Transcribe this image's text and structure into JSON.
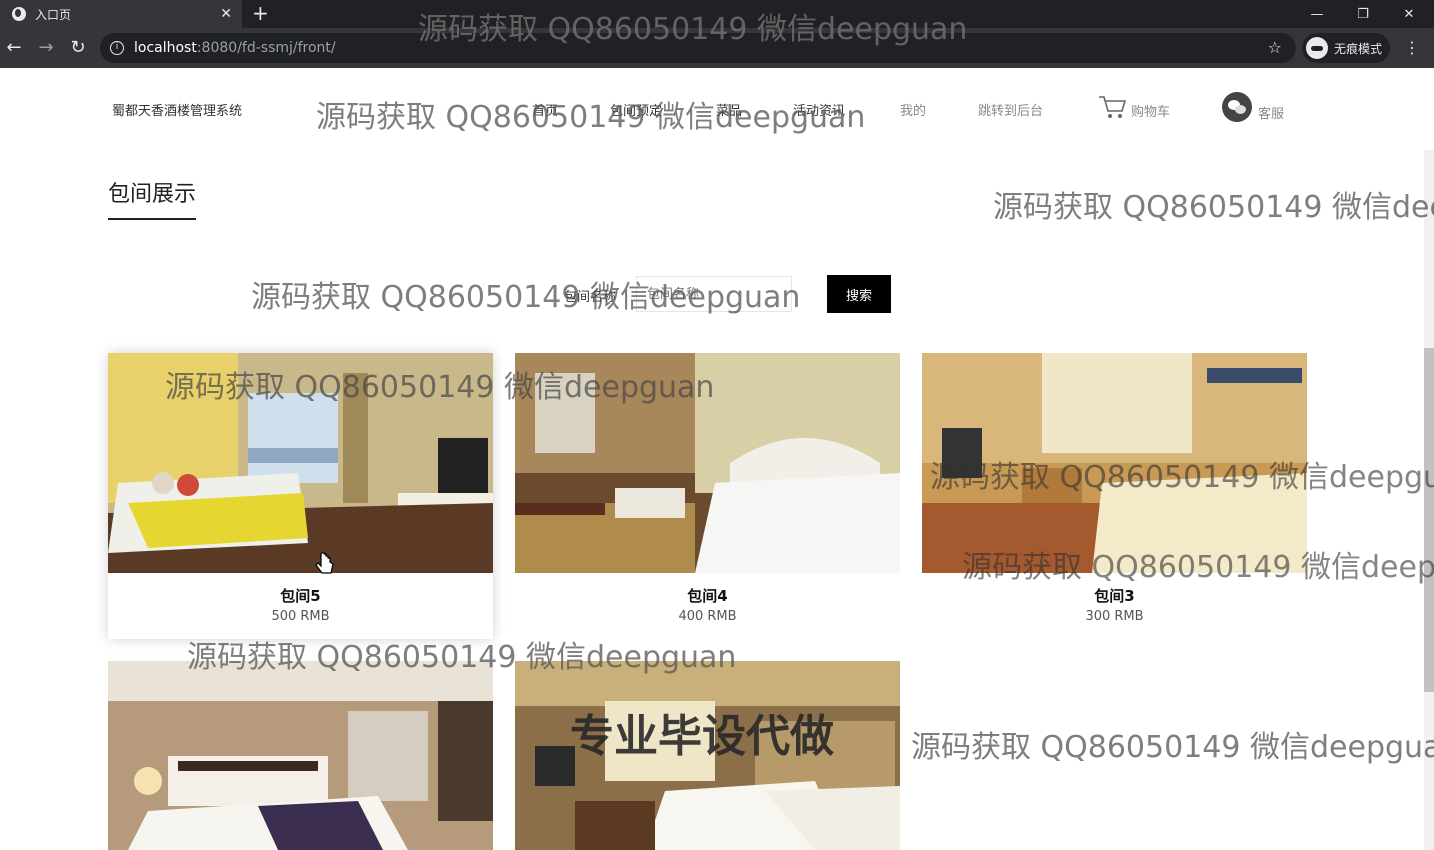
{
  "browser": {
    "tab_title": "入口页",
    "tab_close": "✕",
    "new_tab": "+",
    "url_host": "localhost",
    "url_path": ":8080/fd-ssmj/front/",
    "incognito_label": "无痕模式",
    "window_controls": [
      "—",
      "❐",
      "✕"
    ]
  },
  "header": {
    "brand": "蜀都天香酒楼管理系统",
    "nav": [
      "首页",
      "包间预定",
      "菜品",
      "活动资讯",
      "我的",
      "跳转到后台"
    ],
    "cart_label": "购物车",
    "service_label": "客服"
  },
  "section": {
    "title": "包间展示"
  },
  "search": {
    "label": "包间名称",
    "placeholder": "包间名称",
    "button": "搜索"
  },
  "rooms": [
    {
      "name": "包间5",
      "price": "500 RMB"
    },
    {
      "name": "包间4",
      "price": "400 RMB"
    },
    {
      "name": "包间3",
      "price": "300 RMB"
    }
  ],
  "watermarks": {
    "text": "源码获取 QQ86050149 微信deepguan",
    "banner": "专业毕设代做"
  }
}
